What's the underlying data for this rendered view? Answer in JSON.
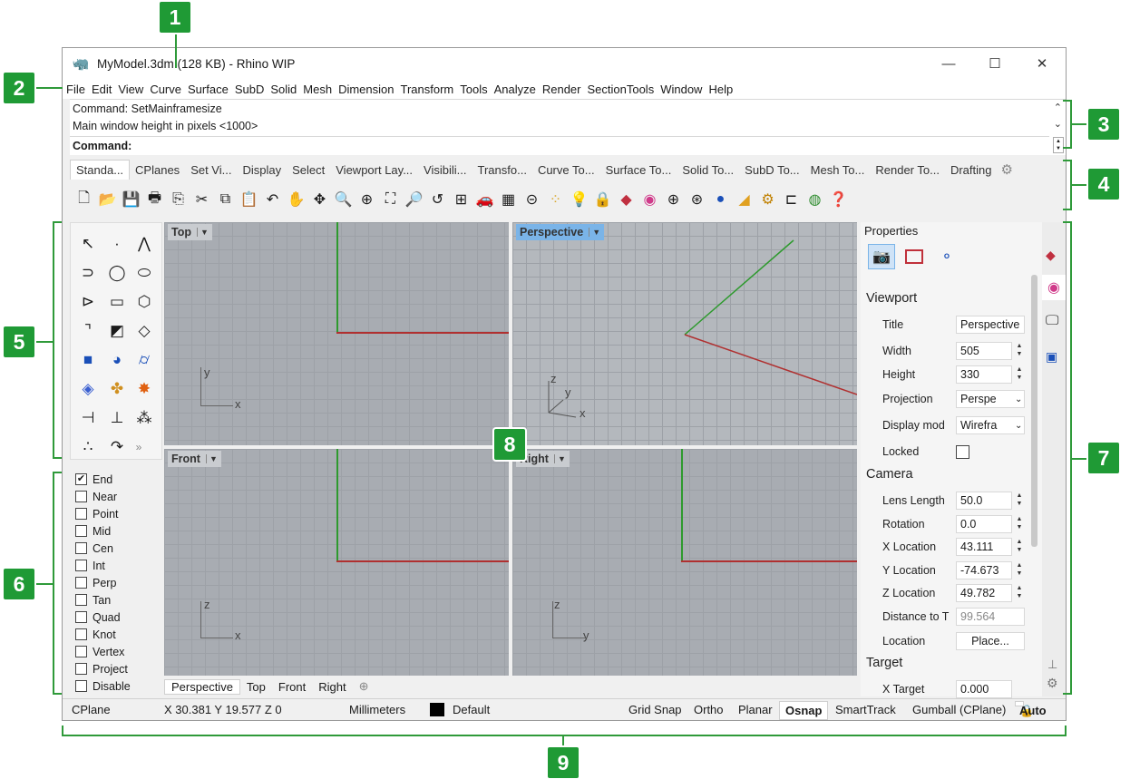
{
  "window": {
    "title": "MyModel.3dm (128 KB) - Rhino WIP",
    "minimize": "—",
    "maximize": "☐",
    "close": "✕"
  },
  "menu": [
    "File",
    "Edit",
    "View",
    "Curve",
    "Surface",
    "SubD",
    "Solid",
    "Mesh",
    "Dimension",
    "Transform",
    "Tools",
    "Analyze",
    "Render",
    "SectionTools",
    "Window",
    "Help"
  ],
  "command": {
    "history_1": "Command: SetMainframesize",
    "history_2": "Main window height in pixels <1000>",
    "prompt": "Command:"
  },
  "toolbar_tabs": [
    "Standa...",
    "CPlanes",
    "Set Vi...",
    "Display",
    "Select",
    "Viewport Lay...",
    "Visibili...",
    "Transfo...",
    "Curve To...",
    "Surface To...",
    "Solid To...",
    "SubD To...",
    "Mesh To...",
    "Render To...",
    "Drafting"
  ],
  "viewports": {
    "top": "Top",
    "perspective": "Perspective",
    "front": "Front",
    "right": "Right"
  },
  "viewport_tabs": [
    "Perspective",
    "Top",
    "Front",
    "Right"
  ],
  "axes": {
    "x": "x",
    "y": "y",
    "z": "z"
  },
  "osnap": [
    {
      "label": "End",
      "checked": true
    },
    {
      "label": "Near",
      "checked": false
    },
    {
      "label": "Point",
      "checked": false
    },
    {
      "label": "Mid",
      "checked": false
    },
    {
      "label": "Cen",
      "checked": false
    },
    {
      "label": "Int",
      "checked": false
    },
    {
      "label": "Perp",
      "checked": false
    },
    {
      "label": "Tan",
      "checked": false
    },
    {
      "label": "Quad",
      "checked": false
    },
    {
      "label": "Knot",
      "checked": false
    },
    {
      "label": "Vertex",
      "checked": false
    },
    {
      "label": "Project",
      "checked": false
    },
    {
      "label": "Disable",
      "checked": false
    }
  ],
  "properties": {
    "header": "Properties",
    "viewport_section": "Viewport",
    "title_label": "Title",
    "title_value": "Perspective",
    "width_label": "Width",
    "width_value": "505",
    "height_label": "Height",
    "height_value": "330",
    "projection_label": "Projection",
    "projection_value": "Perspe",
    "display_label": "Display mod",
    "display_value": "Wirefra",
    "locked_label": "Locked",
    "camera_section": "Camera",
    "lens_label": "Lens Length",
    "lens_value": "50.0",
    "rotation_label": "Rotation",
    "rotation_value": "0.0",
    "xloc_label": "X Location",
    "xloc_value": "43.111",
    "yloc_label": "Y Location",
    "yloc_value": "-74.673",
    "zloc_label": "Z Location",
    "zloc_value": "49.782",
    "dist_label": "Distance to T",
    "dist_value": "99.564",
    "loc_label": "Location",
    "loc_button": "Place...",
    "target_section": "Target",
    "xtarget_label": "X Target",
    "xtarget_value": "0.000"
  },
  "status": {
    "cplane": "CPlane",
    "coords": "X 30.381  Y 19.577  Z 0",
    "units": "Millimeters",
    "layer": "Default",
    "grid_snap": "Grid Snap",
    "ortho": "Ortho",
    "planar": "Planar",
    "osnap": "Osnap",
    "smarttrack": "SmartTrack",
    "gumball": "Gumball (CPlane)",
    "auto": "Auto"
  },
  "callouts": [
    "1",
    "2",
    "3",
    "4",
    "5",
    "6",
    "7",
    "8",
    "9"
  ],
  "colors": {
    "accent": "#1f9a35",
    "x_axis": "#b03030",
    "y_axis": "#2e9a2e",
    "grid": "#a8acb2",
    "active_view": "#7ab4e8"
  }
}
